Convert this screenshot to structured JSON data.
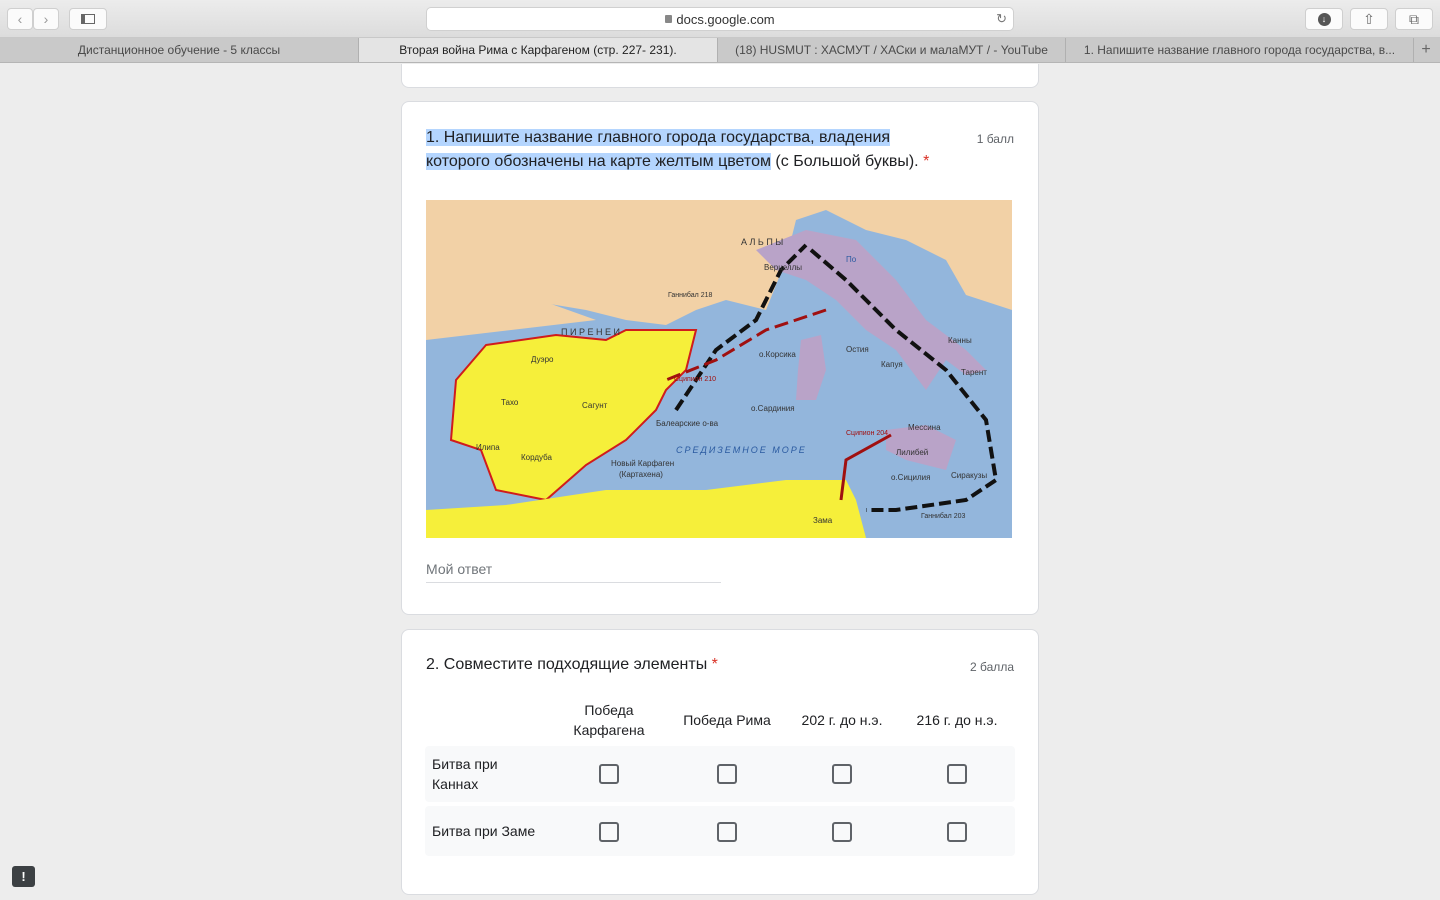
{
  "browser": {
    "url": "docs.google.com",
    "tabs": [
      {
        "label": "Дистанционное обучение - 5 классы"
      },
      {
        "label": "Вторая война Рима с Карфагеном (стр. 227- 231)."
      },
      {
        "label": "(18) HUSMUT : ХАСМУТ / ХАСки и малаМУТ / - YouTube"
      },
      {
        "label": "1. Напишите название главного города государства, в..."
      }
    ],
    "new_tab": "+"
  },
  "q1": {
    "title_highlighted": "1. Напишите название главного города государства, владения которого обозначены на карте желтым цветом",
    "title_rest": " (с Большой буквы). ",
    "required": "*",
    "points": "1 балл",
    "answer_placeholder": "Мой ответ",
    "map_labels": {
      "pyrenees": "П И Р Е Н Е И",
      "duero": "Дуэро",
      "tajo": "Тахо",
      "sagunt": "Сагунт",
      "cordoba": "Кордуба",
      "ilipa": "Илипа",
      "new_carthage": "Новый Карфаген",
      "cartagena": "(Картахена)",
      "hannibal218": "Ганнибал 218",
      "scipio210": "Сципион 210",
      "corsica": "о.Корсика",
      "sardinia": "о.Сардиния",
      "balearic": "Балеарские о-ва",
      "sea": "СРЕДИЗЕМНОЕ МОРЕ",
      "scipio204": "Сципион 204",
      "messina": "Мессина",
      "lilybaeum": "Лилибей",
      "sicily": "о.Сицилия",
      "syracuse": "Сиракузы",
      "hannibal203": "Ганнибал 203",
      "zama": "Зама",
      "capua": "Капуя",
      "cannae": "Канны",
      "tarentum": "Тарент",
      "vercellae": "Верцеллы",
      "alps": "А Л Ь П Ы",
      "po": "По",
      "ostia": "Остия"
    }
  },
  "q2": {
    "title": "2. Совместите подходящие элементы ",
    "required": "*",
    "points": "2 балла",
    "columns": [
      "Победа Карфагена",
      "Победа Рима",
      "202 г. до н.э.",
      "216 г. до н.э."
    ],
    "rows": [
      "Битва при Каннах",
      "Битва при Заме"
    ]
  },
  "feedback_icon": "!"
}
